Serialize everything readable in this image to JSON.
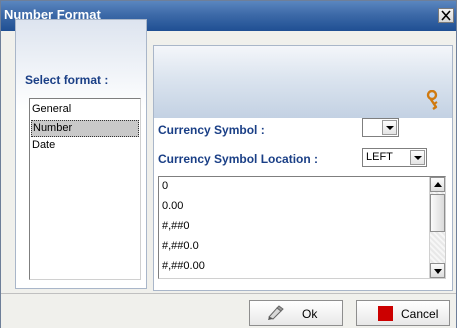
{
  "dialog": {
    "title": "Number Format",
    "close_glyph": "X"
  },
  "left": {
    "select_label": "Select format :",
    "formats": [
      "General",
      "Number",
      "Date"
    ],
    "selected_index": 1
  },
  "right": {
    "header_icon": "key-icon",
    "currency_symbol_label": "Currency Symbol :",
    "currency_symbol_value": "",
    "currency_location_label": "Currency Symbol Location :",
    "currency_location_value": "LEFT",
    "patterns": [
      "0",
      "0.00",
      "#,##0",
      "#,##0.0",
      "#,##0.00"
    ]
  },
  "footer": {
    "ok_label": "Ok",
    "cancel_label": "Cancel",
    "ok_icon": "pencil-check-icon",
    "cancel_icon": "red-square-icon"
  },
  "colors": {
    "title_gradient_top": "#5a86bf",
    "title_gradient_bottom": "#1f4f93",
    "label_blue": "#1a3f86",
    "cancel_red": "#cc0000"
  }
}
